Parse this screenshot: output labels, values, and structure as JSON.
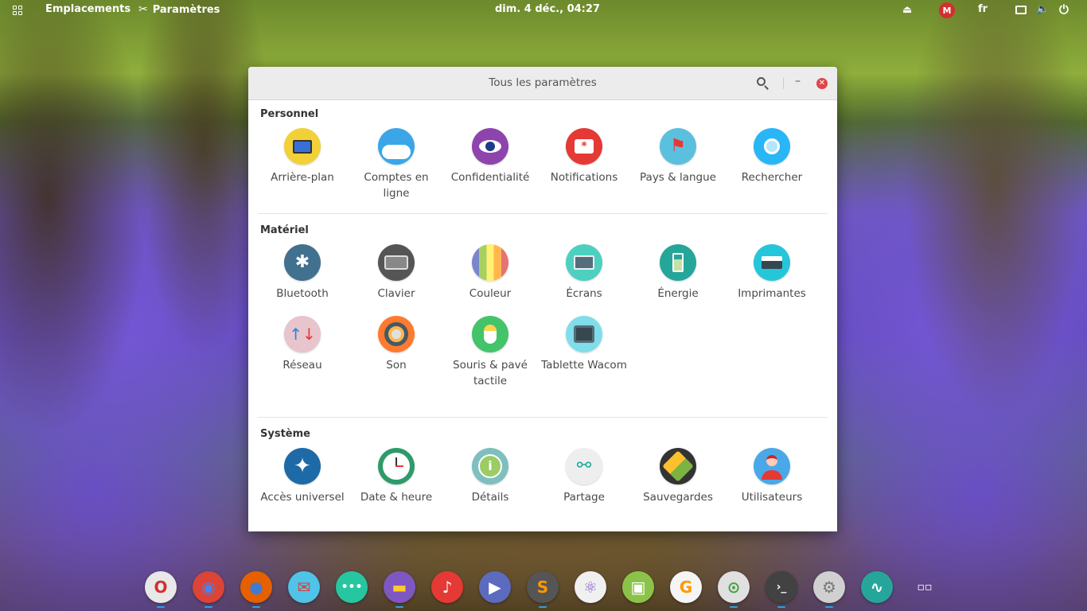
{
  "topbar": {
    "places": "Emplacements",
    "settings": "Paramètres",
    "clock": "dim.  4 déc., 04:27",
    "user_badge": "M",
    "language": "fr"
  },
  "window": {
    "title": "Tous les paramètres"
  },
  "sections": {
    "personal": {
      "title": "Personnel",
      "items": [
        {
          "label": "Arrière-plan",
          "icon": "background-icon",
          "color": "#f2d038"
        },
        {
          "label": "Comptes en ligne",
          "icon": "online-accounts-icon",
          "color": "#3aa6e8"
        },
        {
          "label": "Confidentialité",
          "icon": "privacy-icon",
          "color": "#8e44ad"
        },
        {
          "label": "Notifications",
          "icon": "notifications-icon",
          "color": "#e53935"
        },
        {
          "label": "Pays & langue",
          "icon": "region-language-icon",
          "color": "#5bc0de"
        },
        {
          "label": "Rechercher",
          "icon": "search-icon",
          "color": "#29b6f6"
        }
      ]
    },
    "hardware": {
      "title": "Matériel",
      "items": [
        {
          "label": "Bluetooth",
          "icon": "bluetooth-icon",
          "color": "#42708f"
        },
        {
          "label": "Clavier",
          "icon": "keyboard-icon",
          "color": "#555555"
        },
        {
          "label": "Couleur",
          "icon": "color-icon",
          "color": "#a8d060"
        },
        {
          "label": "Écrans",
          "icon": "displays-icon",
          "color": "#4dd0c0"
        },
        {
          "label": "Énergie",
          "icon": "power-icon",
          "color": "#26a69a"
        },
        {
          "label": "Imprimantes",
          "icon": "printer-icon",
          "color": "#26c6da"
        },
        {
          "label": "Réseau",
          "icon": "network-icon",
          "color": "#e8c4cc"
        },
        {
          "label": "Son",
          "icon": "sound-icon",
          "color": "#ff7a2f"
        },
        {
          "label": "Souris & pavé tactile",
          "icon": "mouse-icon",
          "color": "#43c46a"
        },
        {
          "label": "Tablette Wacom",
          "icon": "wacom-tablet-icon",
          "color": "#80deea"
        }
      ]
    },
    "system": {
      "title": "Système",
      "items": [
        {
          "label": "Accès universel",
          "icon": "universal-access-icon",
          "color": "#1e6aa6"
        },
        {
          "label": "Date & heure",
          "icon": "clock-icon",
          "color": "#2e9a6a"
        },
        {
          "label": "Détails",
          "icon": "info-icon",
          "color": "#7fbfbf"
        },
        {
          "label": "Partage",
          "icon": "sharing-icon",
          "color": "#eeeeee"
        },
        {
          "label": "Sauvegardes",
          "icon": "backups-icon",
          "color": "#333333"
        },
        {
          "label": "Utilisateurs",
          "icon": "users-icon",
          "color": "#4aa8e8"
        }
      ]
    }
  },
  "dock": [
    {
      "name": "opera-icon",
      "color": "#e8e8e8",
      "glyph": "O",
      "fg": "#d32f2f"
    },
    {
      "name": "chrome-icon",
      "color": "#db4437",
      "glyph": "◉",
      "fg": "#4285f4"
    },
    {
      "name": "firefox-icon",
      "color": "#e66000",
      "glyph": "●",
      "fg": "#3f7ad3"
    },
    {
      "name": "mail-icon",
      "color": "#4fc3e8",
      "glyph": "✉",
      "fg": "#e53935"
    },
    {
      "name": "chat-icon",
      "color": "#26c6a0",
      "glyph": "•••",
      "fg": "#ffffff"
    },
    {
      "name": "files-icon",
      "color": "#7e57c2",
      "glyph": "▬",
      "fg": "#ffca28"
    },
    {
      "name": "music-icon",
      "color": "#e53935",
      "glyph": "♪",
      "fg": "#ffffff"
    },
    {
      "name": "video-icon",
      "color": "#5c6bc0",
      "glyph": "▶",
      "fg": "#ffffff"
    },
    {
      "name": "sublime-icon",
      "color": "#555555",
      "glyph": "S",
      "fg": "#ff9800"
    },
    {
      "name": "atom-icon",
      "color": "#f0f0f0",
      "glyph": "⚛",
      "fg": "#8e5bd8"
    },
    {
      "name": "image-viewer-icon",
      "color": "#8bc34a",
      "glyph": "▣",
      "fg": "#ffffff"
    },
    {
      "name": "update-icon",
      "color": "#f5f5f5",
      "glyph": "G",
      "fg": "#ff9800"
    },
    {
      "name": "tweaks-icon",
      "color": "#e0e0e0",
      "glyph": "⊙",
      "fg": "#43a047"
    },
    {
      "name": "terminal-icon",
      "color": "#424242",
      "glyph": "›_",
      "fg": "#ffffff"
    },
    {
      "name": "settings-icon",
      "color": "#d0d0d0",
      "glyph": "⚙",
      "fg": "#777777"
    },
    {
      "name": "system-monitor-icon",
      "color": "#26a69a",
      "glyph": "∿",
      "fg": "#ffffff"
    },
    {
      "name": "show-apps-icon",
      "color": "transparent",
      "glyph": "▫▫",
      "fg": "#ffffff"
    }
  ]
}
